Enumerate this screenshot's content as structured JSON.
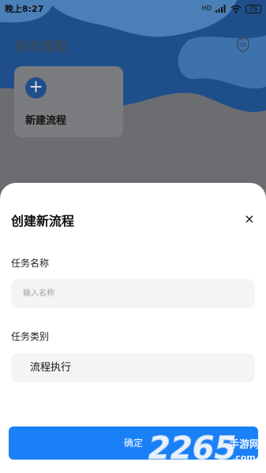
{
  "status_bar": {
    "time": "晚上8:27",
    "signal": "HD",
    "battery": "75"
  },
  "background": {
    "title": "自动流程",
    "card_label": "新建流程",
    "card_plus": "+"
  },
  "sheet": {
    "title": "创建新流程",
    "close": "×",
    "name_label": "任务名称",
    "name_placeholder": "输入名称",
    "name_value": "",
    "category_label": "任务类别",
    "category_value": "流程执行",
    "confirm_label": "确定"
  },
  "watermark": {
    "number": "2265",
    "suffix": "手游网",
    "domain": ".com"
  },
  "colors": {
    "accent": "#1a80f7",
    "wave_dark": "#1f4f8a",
    "wave_light": "#4a7fb8"
  }
}
